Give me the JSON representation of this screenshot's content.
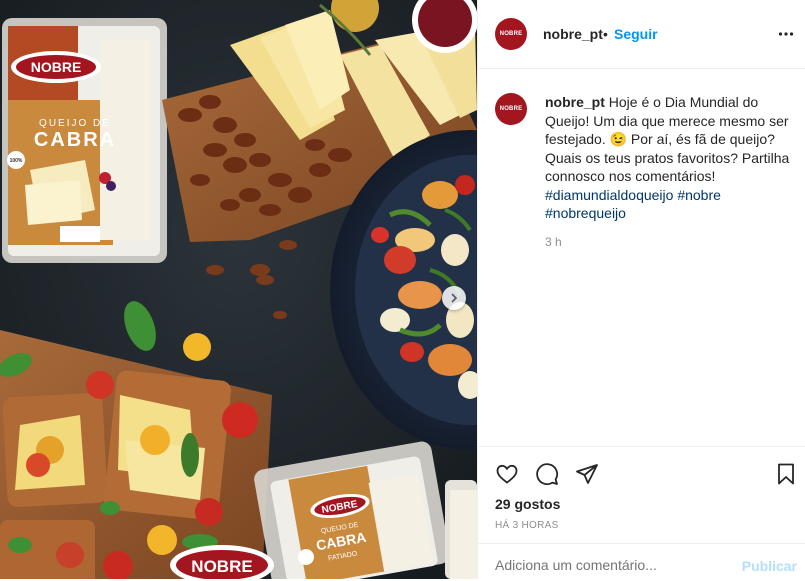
{
  "post_image": {
    "brand_mark": "NOBRE",
    "package_top_line1": "QUEIJO DE",
    "package_top_line2": "CABRA",
    "package_bottom_line1": "QUEIJO DE",
    "package_bottom_line2": "CABRA",
    "package_bottom_line3": "FATIADO",
    "badge": "100%",
    "colors": {
      "brand_red": "#a3151f",
      "slate": "#1d2328"
    }
  },
  "header": {
    "username": "nobre_pt",
    "separator": "•",
    "follow_label": "Seguir",
    "more_icon": "more-horizontal-icon"
  },
  "caption": {
    "username": "nobre_pt",
    "text": "Hoje é o Dia Mundial do Queijo! Um dia que merece mesmo ser festejado. 😉 Por aí, és fã de queijo? Quais os teus pratos favoritos? Partilha connosco nos comentários!",
    "hashtag1": "#diamundialdoqueijo",
    "hashtag2": "#nobre",
    "hashtag3": "#nobrequeijo",
    "time": "3 h"
  },
  "actions": {
    "likes": "29 gostos",
    "ago": "HÁ 3 HORAS"
  },
  "comment": {
    "placeholder": "Adiciona um comentário...",
    "publish_label": "Publicar"
  },
  "avatar_text": "NOBRE"
}
